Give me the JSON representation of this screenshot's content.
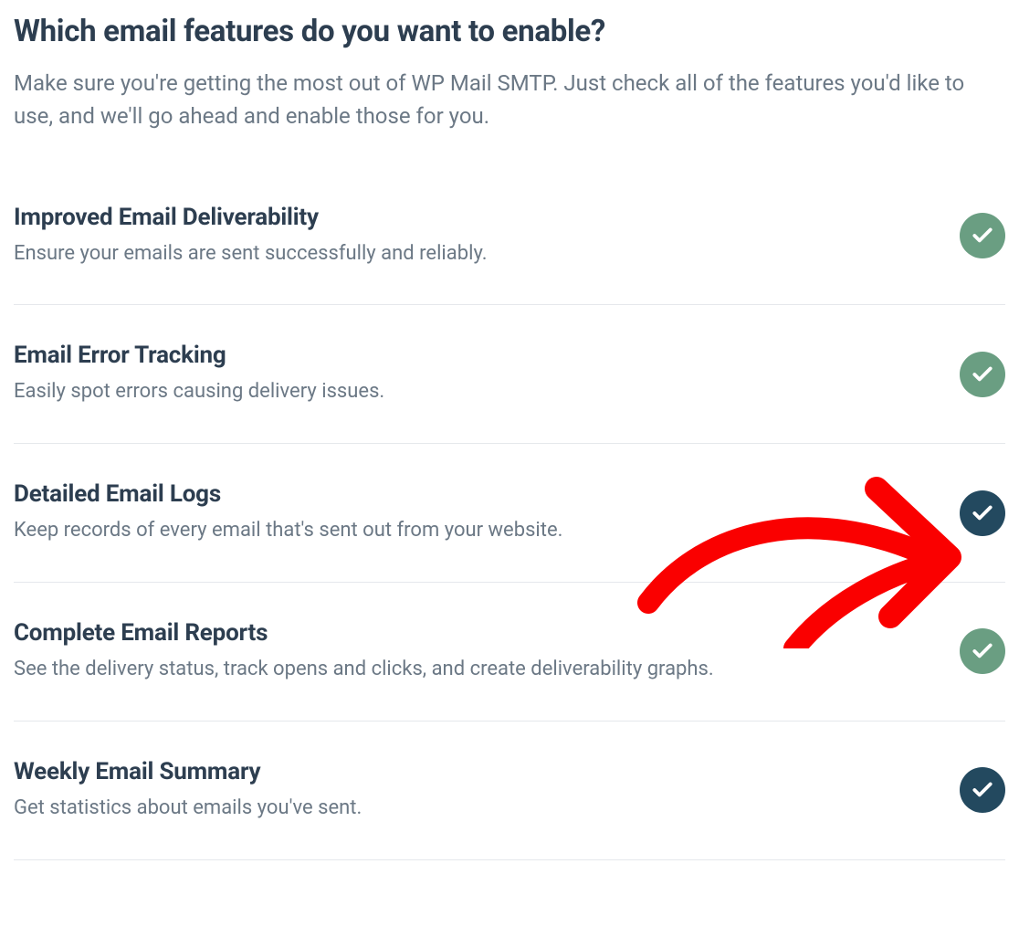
{
  "header": {
    "title": "Which email features do you want to enable?",
    "subtitle": "Make sure you're getting the most out of WP Mail SMTP. Just check all of the features you'd like to use, and we'll go ahead and enable those for you."
  },
  "features": [
    {
      "title": "Improved Email Deliverability",
      "desc": "Ensure your emails are sent successfully and reliably.",
      "state": "green"
    },
    {
      "title": "Email Error Tracking",
      "desc": "Easily spot errors causing delivery issues.",
      "state": "green"
    },
    {
      "title": "Detailed Email Logs",
      "desc": "Keep records of every email that's sent out from your website.",
      "state": "dark"
    },
    {
      "title": "Complete Email Reports",
      "desc": "See the delivery status, track opens and clicks, and create deliverability graphs.",
      "state": "green"
    },
    {
      "title": "Weekly Email Summary",
      "desc": "Get statistics about emails you've sent.",
      "state": "dark"
    }
  ],
  "colors": {
    "green": "#6a9e82",
    "dark": "#23495f",
    "annotation": "#fa0000"
  }
}
